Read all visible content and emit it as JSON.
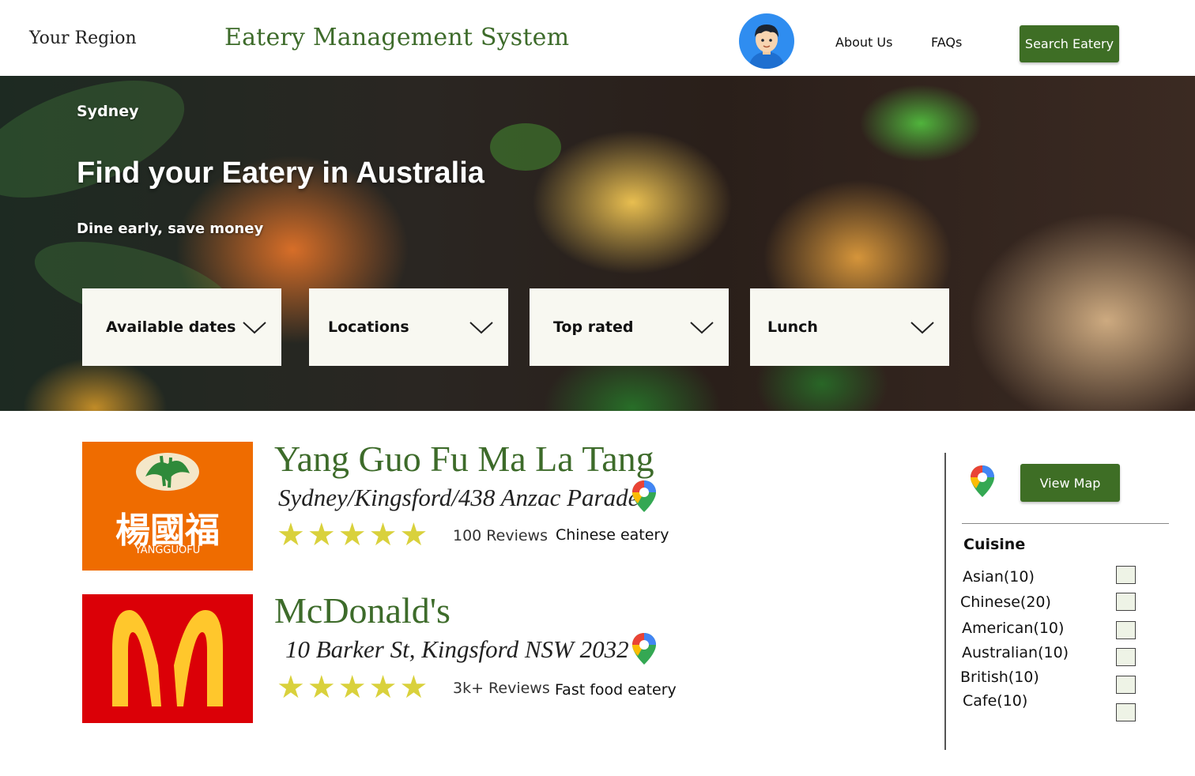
{
  "header": {
    "region_label": "Your Region",
    "app_title": "Eatery Management System",
    "nav": {
      "about": "About Us",
      "faqs": "FAQs"
    },
    "search_button": "Search Eatery"
  },
  "hero": {
    "city": "Sydney",
    "title": "Find your Eatery in Australia",
    "subtitle": "Dine early, save money",
    "filters": [
      "Available dates",
      "Locations",
      "Top rated",
      "Lunch"
    ]
  },
  "restaurants": [
    {
      "name": "Yang Guo Fu Ma La Tang",
      "address": "Sydney/Kingsford/438 Anzac Parade",
      "rating": 5,
      "reviews": "100 Reviews",
      "type": "Chinese eatery",
      "logo_text": "楊國福",
      "logo_sub": "YANGGUOFU",
      "logo_bg": "#ef6c00"
    },
    {
      "name": "McDonald's",
      "address": "10 Barker St, Kingsford NSW 2032",
      "rating": 5,
      "reviews": "3k+ Reviews",
      "type": "Fast food eatery",
      "logo_bg": "#db0007"
    }
  ],
  "sidebar": {
    "map_button": "View Map",
    "cuisine_title": "Cuisine",
    "cuisines": [
      "Asian(10)",
      "Chinese(20)",
      "American(10)",
      "Australian(10)",
      "British(10)",
      "Cafe(10)"
    ]
  },
  "colors": {
    "brand_green": "#3e6e25",
    "title_green": "#3d6b2a",
    "star_yellow": "#d9d13c",
    "dropdown_bg": "#f8f8f1"
  },
  "icons": [
    "avatar-icon",
    "chevron-down-icon",
    "map-pin-icon",
    "star-icon",
    "checkbox-icon"
  ]
}
